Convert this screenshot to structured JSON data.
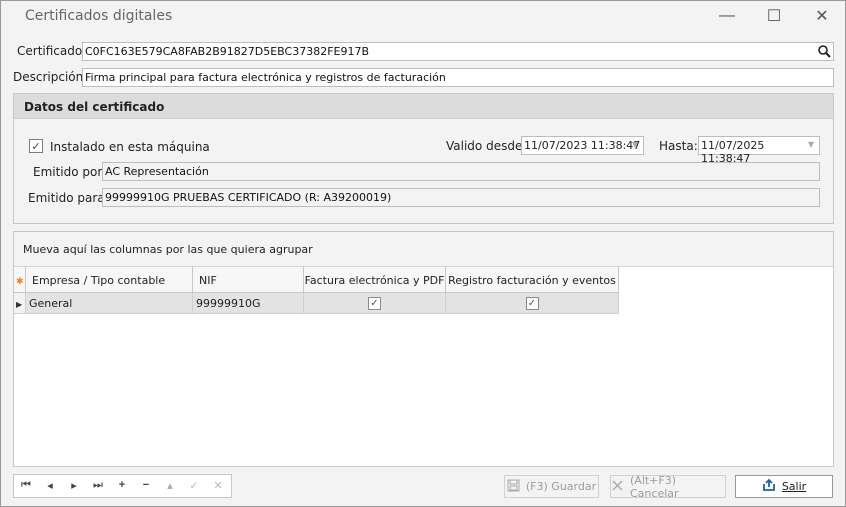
{
  "window": {
    "title": "Certificados digitales",
    "minimize_glyph": "—",
    "maximize_glyph": "☐",
    "close_glyph": "✕"
  },
  "form": {
    "certificado_label": "Certificado:",
    "certificado_value": "C0FC163E579CA8FAB2B91827D5EBC37382FE917B",
    "descripcion_label": "Descripción:",
    "descripcion_value": "Firma principal para factura electrónica y registros de facturación"
  },
  "datos": {
    "title": "Datos del certificado",
    "instalado_label": "Instalado en esta máquina",
    "instalado_checked": true,
    "valido_desde_label": "Valido desde:",
    "valido_desde_value": "11/07/2023 11:38:47",
    "hasta_label": "Hasta:",
    "hasta_value": "11/07/2025 11:38:47",
    "emitido_por_label": "Emitido por:",
    "emitido_por_value": "AC Representación",
    "emitido_para_label": "Emitido para:",
    "emitido_para_value": "99999910G PRUEBAS CERTIFICADO (R: A39200019)"
  },
  "grid": {
    "group_hint": "Mueva aquí las columnas por las que quiera agrupar",
    "columns": [
      "Empresa / Tipo contable",
      "NIF",
      "Factura electrónica y PDF",
      "Registro facturación y eventos"
    ],
    "rows": [
      {
        "empresa": "General",
        "nif": "99999910G",
        "factura": true,
        "registro": true
      }
    ]
  },
  "nav": {
    "buttons": [
      "⏮",
      "◂",
      "▸",
      "⏭",
      "+",
      "−",
      "▴",
      "✓",
      "✕"
    ]
  },
  "buttons": {
    "guardar": "(F3) Guardar",
    "cancelar": "(Alt+F3) Cancelar",
    "salir": "Salir"
  },
  "colors": {
    "accent_icon": "#1f5fa8",
    "row_indicator": "#f08020"
  }
}
